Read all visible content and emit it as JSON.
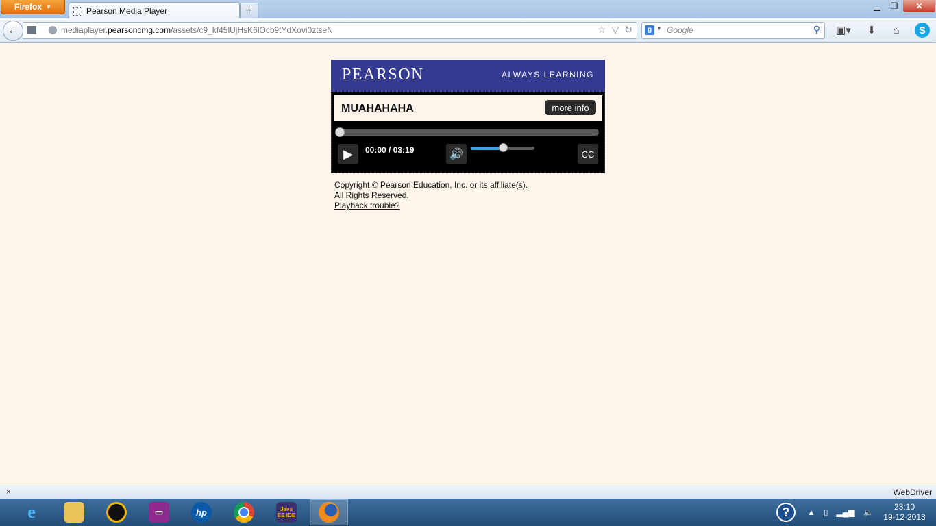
{
  "browser": {
    "menu_button_label": "Firefox",
    "tab_title": "Pearson Media Player",
    "url_prefix": "mediaplayer.",
    "url_host": "pearsoncmg.com",
    "url_path": "/assets/c9_kf45lUjHsK6lOcb9tYdXovi0ztseN",
    "search_placeholder": "Google",
    "search_engine_icon": "g-icon"
  },
  "page": {
    "brand": "PEARSON",
    "tagline": "ALWAYS LEARNING",
    "media_title": "MUAHAHAHA",
    "more_info_label": "more info",
    "time_display": "00:00 / 03:19",
    "cc_label": "CC",
    "playback_progress": 0.0,
    "volume_level": 0.5,
    "copyright_line1": "Copyright © Pearson Education, Inc. or its affiliate(s).",
    "copyright_line2": "All Rights Reserved.",
    "playback_trouble_link": "Playback trouble?",
    "colors": {
      "header_bg": "#343b91",
      "page_bg": "#fdf5ea",
      "accent": "#36a6e8"
    }
  },
  "addon_bar": {
    "close_label": "×",
    "right_label": "WebDriver"
  },
  "taskbar": {
    "apps": [
      "internet-explorer",
      "file-explorer",
      "media-player",
      "projector-app",
      "hp-support",
      "chrome",
      "java-ee-ide",
      "firefox"
    ],
    "java_label": "Java EE IDE",
    "clock_time": "23:10",
    "clock_date": "19-12-2013"
  }
}
